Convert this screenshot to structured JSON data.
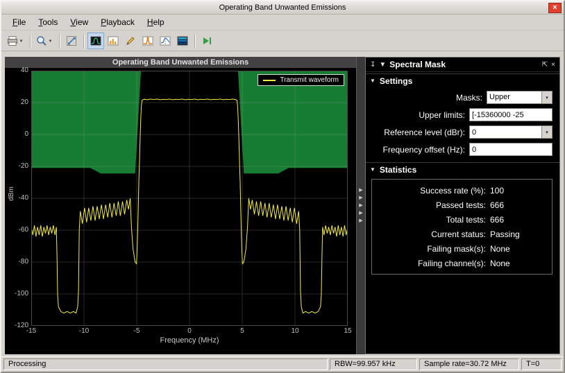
{
  "window": {
    "title": "Operating Band Unwanted Emissions",
    "close_glyph": "×"
  },
  "menu": {
    "items": [
      "File",
      "Tools",
      "View",
      "Playback",
      "Help"
    ]
  },
  "toolbar": {
    "caret_glyph": "▾",
    "icons": [
      "export-dropdown",
      "zoom-dropdown",
      "fit-to-view",
      "spectrum-view",
      "histogram",
      "measurements-pencil",
      "peak-finder",
      "cursor-measurements",
      "spectrogram-view",
      "step-forward"
    ]
  },
  "colors": {
    "chrome": "#d6d3ce",
    "panel_bg": "#000000",
    "close_button": "#df4030"
  },
  "chart_data": {
    "type": "line",
    "title": "Operating Band Unwanted Emissions",
    "xlabel": "Frequency (MHz)",
    "ylabel": "dBm",
    "xlim": [
      -15,
      15
    ],
    "ylim": [
      -120,
      40
    ],
    "xticks": [
      -15,
      -10,
      -5,
      0,
      5,
      10,
      15
    ],
    "yticks": [
      40,
      20,
      0,
      -20,
      -40,
      -60,
      -80,
      -100,
      -120
    ],
    "grid": true,
    "legend_position": "top-right",
    "legend": [
      "Transmit waveform"
    ],
    "trace_color": "#f6ef3a",
    "mask_color": "#177d33",
    "mask_name": "Upper spectral mask",
    "mask_polygons": [
      [
        [
          -15,
          40
        ],
        [
          -15,
          -21
        ],
        [
          -9.4,
          -21
        ],
        [
          -8.4,
          -24.5
        ],
        [
          -5.15,
          -24.5
        ],
        [
          -4.6,
          40
        ]
      ],
      [
        [
          4.6,
          40
        ],
        [
          5.15,
          -24.5
        ],
        [
          8.4,
          -24.5
        ],
        [
          9.4,
          -21
        ],
        [
          15,
          -21
        ],
        [
          15,
          40
        ]
      ]
    ],
    "series": [
      {
        "name": "Transmit waveform",
        "points": [
          [
            -15.0,
            -58
          ],
          [
            -14.85,
            -63
          ],
          [
            -14.7,
            -57
          ],
          [
            -14.55,
            -64
          ],
          [
            -14.4,
            -58
          ],
          [
            -14.25,
            -63
          ],
          [
            -14.1,
            -57
          ],
          [
            -13.95,
            -64
          ],
          [
            -13.8,
            -58
          ],
          [
            -13.65,
            -62
          ],
          [
            -13.5,
            -57
          ],
          [
            -13.35,
            -63
          ],
          [
            -13.2,
            -58
          ],
          [
            -13.05,
            -62
          ],
          [
            -12.9,
            -57
          ],
          [
            -12.75,
            -63
          ],
          [
            -12.62,
            -58
          ],
          [
            -12.55,
            -78
          ],
          [
            -12.5,
            -100
          ],
          [
            -12.42,
            -108
          ],
          [
            -12.2,
            -111
          ],
          [
            -11.9,
            -112
          ],
          [
            -11.6,
            -111
          ],
          [
            -11.3,
            -112
          ],
          [
            -11.0,
            -111
          ],
          [
            -10.75,
            -112
          ],
          [
            -10.6,
            -108
          ],
          [
            -10.52,
            -98
          ],
          [
            -10.45,
            -60
          ],
          [
            -10.35,
            -48
          ],
          [
            -10.15,
            -56
          ],
          [
            -9.95,
            -46
          ],
          [
            -9.75,
            -55
          ],
          [
            -9.55,
            -46
          ],
          [
            -9.35,
            -54
          ],
          [
            -9.15,
            -45
          ],
          [
            -8.95,
            -54
          ],
          [
            -8.75,
            -45
          ],
          [
            -8.55,
            -53
          ],
          [
            -8.35,
            -44
          ],
          [
            -8.15,
            -53
          ],
          [
            -7.95,
            -44
          ],
          [
            -7.75,
            -52
          ],
          [
            -7.55,
            -43
          ],
          [
            -7.35,
            -52
          ],
          [
            -7.15,
            -43
          ],
          [
            -6.95,
            -51
          ],
          [
            -6.75,
            -42
          ],
          [
            -6.55,
            -51
          ],
          [
            -6.35,
            -42
          ],
          [
            -6.15,
            -50
          ],
          [
            -5.95,
            -41
          ],
          [
            -5.78,
            -47
          ],
          [
            -5.62,
            -40
          ],
          [
            -5.5,
            -58
          ],
          [
            -5.35,
            -72
          ],
          [
            -5.15,
            -80
          ],
          [
            -5.02,
            -81
          ],
          [
            -4.96,
            -72
          ],
          [
            -4.9,
            -58
          ],
          [
            -4.85,
            -44
          ],
          [
            -4.8,
            -30
          ],
          [
            -4.74,
            -16
          ],
          [
            -4.68,
            -2
          ],
          [
            -4.62,
            10
          ],
          [
            -4.56,
            18
          ],
          [
            -4.5,
            21.5
          ],
          [
            -4.3,
            22.1
          ],
          [
            -4.0,
            21.8
          ],
          [
            -3.7,
            22.2
          ],
          [
            -3.4,
            21.9
          ],
          [
            -3.1,
            22.2
          ],
          [
            -2.8,
            21.8
          ],
          [
            -2.5,
            22.1
          ],
          [
            -2.2,
            21.9
          ],
          [
            -1.9,
            22.2
          ],
          [
            -1.6,
            21.8
          ],
          [
            -1.3,
            22.1
          ],
          [
            -1.0,
            21.9
          ],
          [
            -0.7,
            22.2
          ],
          [
            -0.4,
            21.8
          ],
          [
            -0.1,
            22.1
          ],
          [
            0.2,
            21.9
          ],
          [
            0.5,
            22.2
          ],
          [
            0.8,
            21.8
          ],
          [
            1.1,
            22.1
          ],
          [
            1.4,
            21.9
          ],
          [
            1.7,
            22.2
          ],
          [
            2.0,
            21.8
          ],
          [
            2.3,
            22.1
          ],
          [
            2.6,
            21.9
          ],
          [
            2.9,
            22.2
          ],
          [
            3.2,
            21.8
          ],
          [
            3.5,
            22.1
          ],
          [
            3.8,
            21.9
          ],
          [
            4.1,
            22.2
          ],
          [
            4.4,
            21.8
          ],
          [
            4.5,
            21.5
          ],
          [
            4.56,
            18
          ],
          [
            4.62,
            10
          ],
          [
            4.68,
            -2
          ],
          [
            4.74,
            -16
          ],
          [
            4.8,
            -30
          ],
          [
            4.85,
            -44
          ],
          [
            4.9,
            -58
          ],
          [
            4.96,
            -72
          ],
          [
            5.02,
            -81
          ],
          [
            5.15,
            -80
          ],
          [
            5.35,
            -72
          ],
          [
            5.5,
            -58
          ],
          [
            5.62,
            -40
          ],
          [
            5.78,
            -47
          ],
          [
            5.95,
            -41
          ],
          [
            6.15,
            -50
          ],
          [
            6.35,
            -42
          ],
          [
            6.55,
            -51
          ],
          [
            6.75,
            -42
          ],
          [
            6.95,
            -51
          ],
          [
            7.15,
            -43
          ],
          [
            7.35,
            -52
          ],
          [
            7.55,
            -43
          ],
          [
            7.75,
            -52
          ],
          [
            7.95,
            -44
          ],
          [
            8.15,
            -53
          ],
          [
            8.35,
            -44
          ],
          [
            8.55,
            -53
          ],
          [
            8.75,
            -45
          ],
          [
            8.95,
            -54
          ],
          [
            9.15,
            -45
          ],
          [
            9.35,
            -54
          ],
          [
            9.55,
            -46
          ],
          [
            9.75,
            -55
          ],
          [
            9.95,
            -46
          ],
          [
            10.15,
            -56
          ],
          [
            10.35,
            -48
          ],
          [
            10.45,
            -60
          ],
          [
            10.52,
            -98
          ],
          [
            10.6,
            -108
          ],
          [
            10.75,
            -112
          ],
          [
            11.0,
            -111
          ],
          [
            11.3,
            -112
          ],
          [
            11.6,
            -111
          ],
          [
            11.9,
            -112
          ],
          [
            12.2,
            -111
          ],
          [
            12.42,
            -108
          ],
          [
            12.5,
            -100
          ],
          [
            12.55,
            -78
          ],
          [
            12.62,
            -58
          ],
          [
            12.75,
            -63
          ],
          [
            12.9,
            -57
          ],
          [
            13.05,
            -62
          ],
          [
            13.2,
            -58
          ],
          [
            13.35,
            -63
          ],
          [
            13.5,
            -57
          ],
          [
            13.65,
            -62
          ],
          [
            13.8,
            -58
          ],
          [
            13.95,
            -64
          ],
          [
            14.1,
            -57
          ],
          [
            14.25,
            -63
          ],
          [
            14.4,
            -58
          ],
          [
            14.55,
            -64
          ],
          [
            14.7,
            -57
          ],
          [
            14.85,
            -63
          ],
          [
            15.0,
            -58
          ]
        ]
      }
    ]
  },
  "splitter": {
    "arrows": [
      "▶",
      "▶",
      "▶",
      "▶",
      "▶"
    ]
  },
  "panel": {
    "title": "Spectral Mask",
    "icons": {
      "dock": "↧",
      "collapse": "▼",
      "undock": "⇱",
      "close": "×",
      "caret": "▾"
    },
    "settings": {
      "title": "Settings",
      "fields": [
        {
          "name": "masks",
          "label": "Masks:",
          "value": "Upper",
          "type": "dropdown"
        },
        {
          "name": "upper-limits",
          "label": "Upper limits:",
          "value": "[-15360000 -25",
          "type": "text"
        },
        {
          "name": "reference-level",
          "label": "Reference level (dBr):",
          "value": "0",
          "type": "combo"
        },
        {
          "name": "frequency-offset",
          "label": "Frequency offset (Hz):",
          "value": "0",
          "type": "text"
        }
      ]
    },
    "statistics": {
      "title": "Statistics",
      "rows": [
        {
          "label": "Success rate (%):",
          "value": "100"
        },
        {
          "label": "Passed tests:",
          "value": "666"
        },
        {
          "label": "Total tests:",
          "value": "666"
        },
        {
          "label": "Current status:",
          "value": "Passing"
        },
        {
          "label": "Failing mask(s):",
          "value": "None"
        },
        {
          "label": "Failing channel(s):",
          "value": "None"
        }
      ]
    }
  },
  "statusbar": {
    "left": "Processing",
    "cells": [
      "RBW=99.957 kHz",
      "Sample rate=30.72 MHz",
      "T=0"
    ]
  }
}
